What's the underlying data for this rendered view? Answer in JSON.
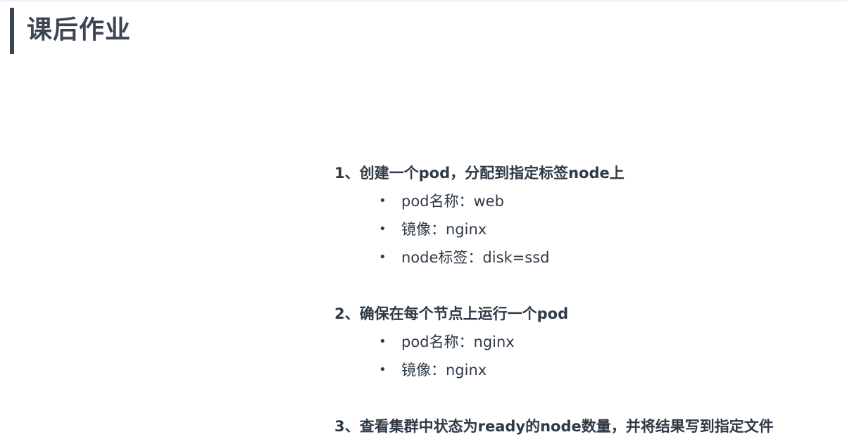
{
  "title": "课后作业",
  "tasks": [
    {
      "heading": "1、创建一个pod，分配到指定标签node上",
      "items": [
        "pod名称：web",
        "镜像：nginx",
        "node标签：disk=ssd"
      ]
    },
    {
      "heading": "2、确保在每个节点上运行一个pod",
      "items": [
        "pod名称：nginx",
        "镜像：nginx"
      ]
    },
    {
      "heading": "3、查看集群中状态为ready的node数量，并将结果写到指定文件",
      "items": []
    }
  ],
  "bullet_glyph": "•"
}
